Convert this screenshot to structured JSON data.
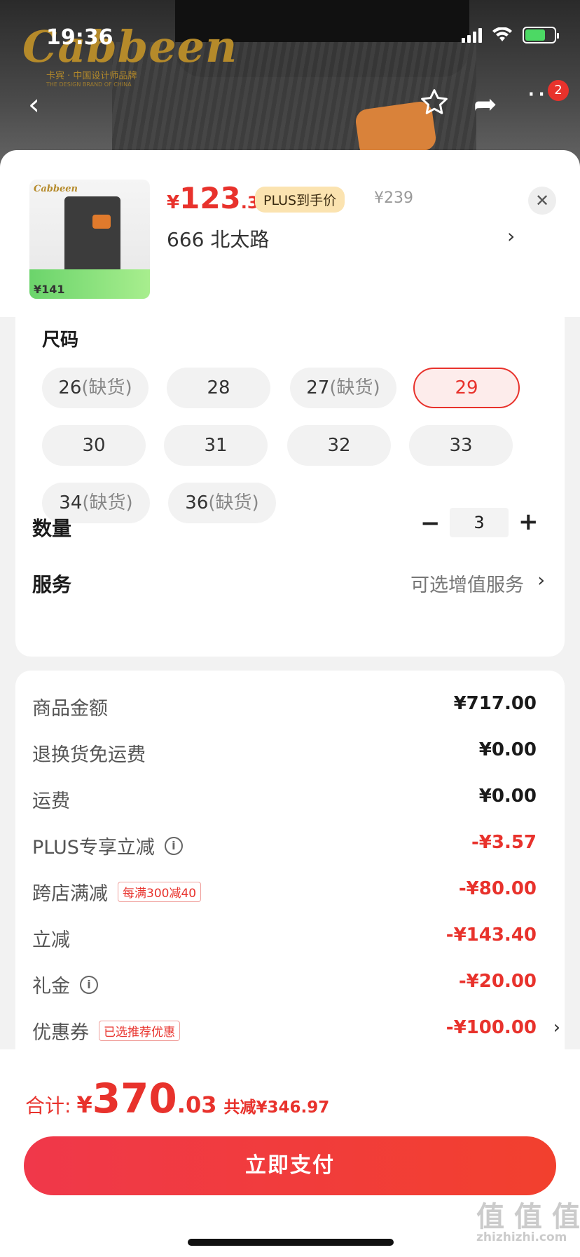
{
  "status_bar": {
    "time": "19:36"
  },
  "brand": {
    "name": "Cabbeen",
    "tagline": "卡宾 · 中国设计师品牌",
    "sub": "THE DESIGN BRAND OF CHINA"
  },
  "nav": {
    "back_icon": "chevron-left",
    "favorite_icon": "star",
    "share_icon": "share",
    "more_icon": "ellipsis",
    "badge_count": "2"
  },
  "product": {
    "price_symbol": "¥",
    "price_int": "123",
    "price_dec": ".34",
    "plus_tag": "PLUS到手价",
    "original_price": "¥239",
    "thumb_logo": "Cabbeen",
    "thumb_price": "¥141"
  },
  "address": {
    "text": "666  北太路",
    "chevron": "›"
  },
  "options": {
    "size_title": "尺码",
    "sizes": [
      {
        "value": "26",
        "note": "(缺货)",
        "selected": false
      },
      {
        "value": "28",
        "note": "",
        "selected": false
      },
      {
        "value": "27",
        "note": "(缺货)",
        "selected": false
      },
      {
        "value": "29",
        "note": "",
        "selected": true
      },
      {
        "value": "30",
        "note": "",
        "selected": false
      },
      {
        "value": "31",
        "note": "",
        "selected": false
      },
      {
        "value": "32",
        "note": "",
        "selected": false
      },
      {
        "value": "33",
        "note": "",
        "selected": false
      },
      {
        "value": "34",
        "note": "(缺货)",
        "selected": false
      },
      {
        "value": "36",
        "note": "(缺货)",
        "selected": false
      }
    ],
    "quantity_label": "数量",
    "quantity_value": "3",
    "minus": "−",
    "plus": "+",
    "service_label": "服务",
    "service_value": "可选增值服务",
    "service_chevron": "›"
  },
  "details": {
    "rows": [
      {
        "label": "商品金额",
        "value": "¥717.00",
        "red": false
      },
      {
        "label": "退换货免运费",
        "value": "¥0.00",
        "red": false
      },
      {
        "label": "运费",
        "value": "¥0.00",
        "red": false
      },
      {
        "label": "PLUS专享立减",
        "value": "-¥3.57",
        "red": true,
        "info": true
      },
      {
        "label": "跨店满减",
        "value": "-¥80.00",
        "red": true,
        "tag": "每满300减40"
      },
      {
        "label": "立减",
        "value": "-¥143.40",
        "red": true
      },
      {
        "label": "礼金",
        "value": "-¥20.00",
        "red": true,
        "info": true
      },
      {
        "label": "优惠券",
        "value": "-¥100.00",
        "red": true,
        "tag": "已选推荐优惠",
        "chevron": "›"
      }
    ]
  },
  "footer": {
    "total_label": "合计:",
    "total_symbol": "¥",
    "total_int": "370",
    "total_dec": ".03",
    "saved": "共减¥346.97",
    "pay_button": "立即支付",
    "watermark": "值 值 值",
    "watermark_sub": "zhizhizhi.com"
  }
}
